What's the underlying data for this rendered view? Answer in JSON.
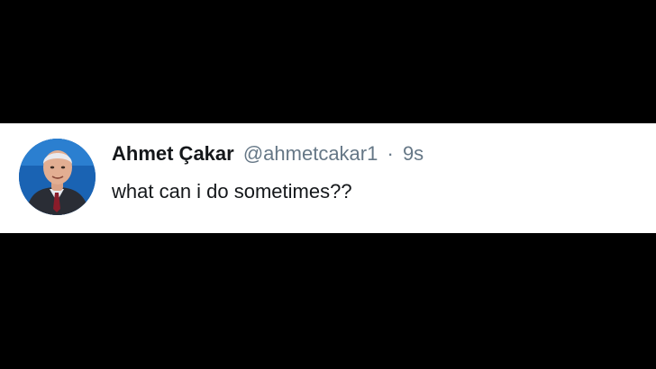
{
  "tweet": {
    "display_name": "Ahmet Çakar",
    "handle": "@ahmetcakar1",
    "separator": "·",
    "timestamp": "9s",
    "text": "what can i do sometimes??"
  },
  "colors": {
    "background": "#000000",
    "card": "#ffffff",
    "name": "#14171a",
    "meta": "#657786",
    "avatar_bg": "#1a63b3"
  },
  "icons": {
    "avatar": "profile-photo"
  }
}
